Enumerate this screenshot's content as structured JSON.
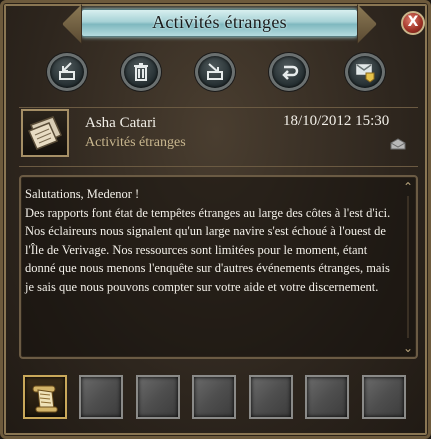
{
  "window": {
    "title": "Activités étranges",
    "close_glyph": "X"
  },
  "toolbar": {
    "buttons": [
      {
        "icon": "reply-icon"
      },
      {
        "icon": "delete-icon"
      },
      {
        "icon": "forward-icon"
      },
      {
        "icon": "return-icon"
      },
      {
        "icon": "take-attachment-icon"
      }
    ]
  },
  "header": {
    "sender": "Asha Catari",
    "subject": "Activités étranges",
    "date": "18/10/2012 15:30",
    "portrait_icon": "letter-icon",
    "status_icon": "envelope-open-icon"
  },
  "message": {
    "greeting": "Salutations, Medenor !",
    "body": "Des rapports font état de tempêtes étranges au large des côtes à l'est d'ici. Nos éclaireurs nous signalent qu'un large navire s'est échoué à l'ouest de l'Île de Verivage. Nos ressources sont limitées pour le moment, étant donné que nous menons l'enquête sur d'autres événements étranges, mais je sais que nous pouvons compter sur votre aide et votre discernement."
  },
  "attachments": {
    "slots": [
      {
        "filled": true,
        "icon": "scroll-icon"
      },
      {
        "filled": false
      },
      {
        "filled": false
      },
      {
        "filled": false
      },
      {
        "filled": false
      },
      {
        "filled": false
      },
      {
        "filled": false
      }
    ]
  },
  "colors": {
    "title_bar": "#a7d2d6",
    "frame": "#8a7653",
    "subject_text": "#c8b68e",
    "close_button": "#a13428"
  }
}
